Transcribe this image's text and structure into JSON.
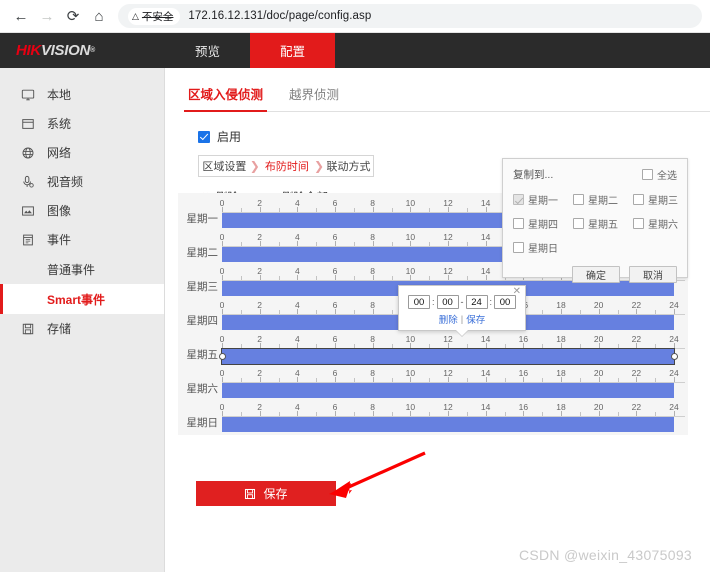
{
  "browser": {
    "back_icon": "arrow-left-icon",
    "forward_icon": "arrow-right-icon",
    "reload_icon": "reload-icon",
    "home_icon": "home-icon",
    "security_warning": "不安全",
    "url": "172.16.12.131/doc/page/config.asp"
  },
  "topnav": {
    "brand_hik": "HIK",
    "brand_vision": "VISION",
    "brand_reg": "®",
    "items": [
      {
        "label": "预览",
        "active": false
      },
      {
        "label": "配置",
        "active": true
      }
    ]
  },
  "sidebar": {
    "items": [
      {
        "label": "本地",
        "icon": "monitor-icon"
      },
      {
        "label": "系统",
        "icon": "window-icon"
      },
      {
        "label": "网络",
        "icon": "globe-icon"
      },
      {
        "label": "视音频",
        "icon": "microphone-icon"
      },
      {
        "label": "图像",
        "icon": "picture-icon"
      },
      {
        "label": "事件",
        "icon": "calendar-icon"
      }
    ],
    "sub_items": [
      {
        "label": "普通事件",
        "active": false
      },
      {
        "label": "Smart事件",
        "active": true
      }
    ],
    "storage": {
      "label": "存储",
      "icon": "save-disk-icon"
    }
  },
  "main": {
    "tabs": [
      {
        "label": "区域入侵侦测",
        "active": true
      },
      {
        "label": "越界侦测",
        "active": false
      }
    ],
    "enable": {
      "label": "启用",
      "checked": true
    },
    "process_tabs": [
      {
        "label": "区域设置",
        "active": false
      },
      {
        "label": "布防时间",
        "active": true
      },
      {
        "label": "联动方式",
        "active": false
      }
    ],
    "toolbar": [
      {
        "label": "删除",
        "icon": "close-x-icon"
      },
      {
        "label": "删除全部",
        "icon": "trash-icon"
      }
    ],
    "save_button": {
      "label": "保存",
      "icon": "save-disk-icon",
      "color": "#e02020"
    }
  },
  "schedule": {
    "axis_ticks": [
      0,
      2,
      4,
      6,
      8,
      10,
      12,
      14,
      16,
      18,
      20,
      22,
      24
    ],
    "axis_max": 24,
    "bar_color": "#6680e0",
    "rows": [
      {
        "day": "星期一",
        "start": 0,
        "end": 24,
        "selected": false
      },
      {
        "day": "星期二",
        "start": 0,
        "end": 24,
        "selected": false
      },
      {
        "day": "星期三",
        "start": 0,
        "end": 24,
        "selected": false
      },
      {
        "day": "星期四",
        "start": 0,
        "end": 24,
        "selected": false
      },
      {
        "day": "星期五",
        "start": 0,
        "end": 24,
        "selected": true
      },
      {
        "day": "星期六",
        "start": 0,
        "end": 24,
        "selected": false
      },
      {
        "day": "星期日",
        "start": 0,
        "end": 24,
        "selected": false
      }
    ]
  },
  "time_popup": {
    "close_icon": "close-icon",
    "start_hour": "00",
    "start_minute": "00",
    "end_hour": "24",
    "end_minute": "00",
    "sep_colon": ":",
    "sep_dash": "-",
    "delete_link": "删除",
    "link_divider": "|",
    "save_link": "保存"
  },
  "copy_dialog": {
    "title": "复制到...",
    "select_all": {
      "label": "全选",
      "checked": false
    },
    "days": [
      {
        "label": "星期一",
        "checked": true,
        "disabled": true
      },
      {
        "label": "星期二",
        "checked": false,
        "disabled": false
      },
      {
        "label": "星期三",
        "checked": false,
        "disabled": false
      },
      {
        "label": "星期四",
        "checked": false,
        "disabled": false
      },
      {
        "label": "星期五",
        "checked": false,
        "disabled": false
      },
      {
        "label": "星期六",
        "checked": false,
        "disabled": false
      },
      {
        "label": "星期日",
        "checked": false,
        "disabled": false
      }
    ],
    "confirm": "确定",
    "cancel": "取消"
  },
  "watermark": "CSDN @weixin_43075093"
}
